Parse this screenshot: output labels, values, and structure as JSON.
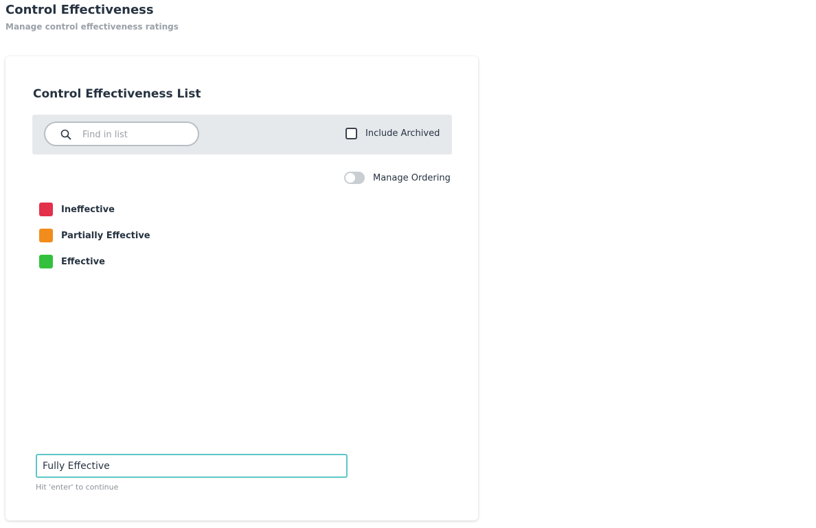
{
  "header": {
    "title": "Control Effectiveness",
    "subtitle": "Manage control effectiveness ratings"
  },
  "card": {
    "title": "Control Effectiveness List"
  },
  "search": {
    "placeholder": "Find in list",
    "value": "",
    "icon": "search-icon"
  },
  "filters": {
    "include_archived_label": "Include Archived",
    "include_archived_checked": false,
    "manage_ordering_label": "Manage Ordering",
    "manage_ordering_on": false
  },
  "ratings": [
    {
      "label": "Ineffective",
      "color": "#e3304b"
    },
    {
      "label": "Partially Effective",
      "color": "#f28c1c"
    },
    {
      "label": "Effective",
      "color": "#33c13d"
    }
  ],
  "new_rating": {
    "value": "Fully Effective",
    "hint": "Hit 'enter' to continue"
  },
  "colors": {
    "input_focus_border": "#5cc6c8",
    "filter_bar_bg": "#e6e9ec"
  }
}
